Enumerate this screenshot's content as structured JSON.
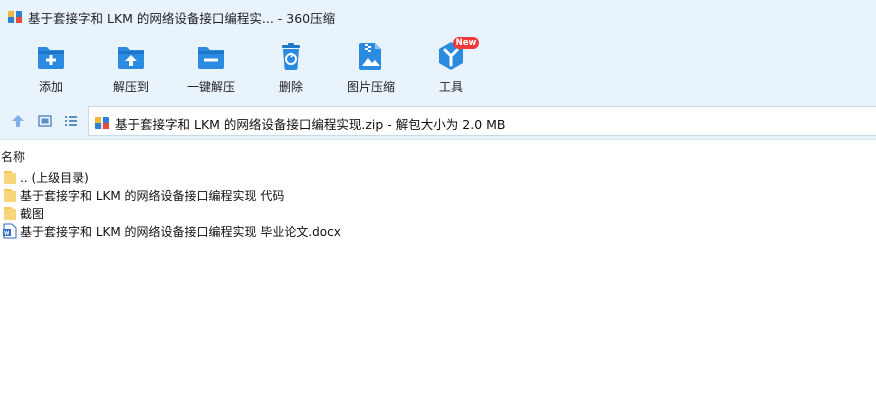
{
  "window": {
    "title": "基于套接字和 LKM 的网络设备接口编程实... - 360压缩"
  },
  "toolbar": {
    "items": [
      {
        "label": "添加",
        "icon": "add-icon"
      },
      {
        "label": "解压到",
        "icon": "extract-to-icon"
      },
      {
        "label": "一键解压",
        "icon": "one-click-extract-icon"
      },
      {
        "label": "删除",
        "icon": "delete-icon"
      },
      {
        "label": "图片压缩",
        "icon": "image-compress-icon"
      },
      {
        "label": "工具",
        "icon": "tools-icon",
        "badge": "New"
      }
    ]
  },
  "nav": {
    "up_icon": "up-arrow-icon",
    "thumbnail_icon": "thumbnail-view-icon",
    "list_icon": "list-view-icon"
  },
  "address": {
    "text": "基于套接字和 LKM 的网络设备接口编程实现.zip - 解包大小为 2.0 MB"
  },
  "columns": {
    "name": "名称"
  },
  "files": [
    {
      "name": ".. (上级目录)",
      "type": "parent-folder"
    },
    {
      "name": "基于套接字和 LKM 的网络设备接口编程实现 代码",
      "type": "folder"
    },
    {
      "name": "截图",
      "type": "folder"
    },
    {
      "name": "基于套接字和 LKM 的网络设备接口编程实现 毕业论文.docx",
      "type": "docx"
    }
  ],
  "colors": {
    "toolbar_bg": "#e9f3fc",
    "icon_blue": "#2a8be0",
    "folder_yellow": "#f6c85a",
    "badge_red": "#f03a3a"
  }
}
